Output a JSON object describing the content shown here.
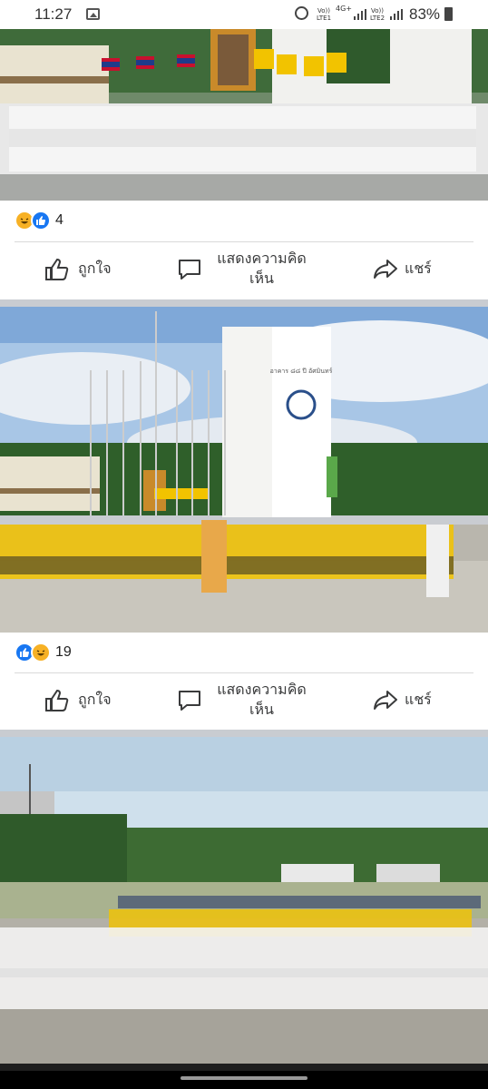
{
  "status_bar": {
    "time": "11:27",
    "sim1": "Vo)) LTE1",
    "sim1_network": "4G+",
    "sim2": "Vo)) LTE2",
    "battery": "83%"
  },
  "posts": [
    {
      "photo_icon": "image-group-officers-white-uniform",
      "reaction_icons": [
        "haha-icon",
        "like-icon"
      ],
      "reaction_count": "4",
      "like_label": "ถูกใจ",
      "comment_label": "แสดงความคิดเห็น",
      "share_label": "แชร์"
    },
    {
      "photo_icon": "image-yellow-shirts-ceremony",
      "building_sign": "อาคาร ๘๘ ปี อัศมินทร์",
      "reaction_icons": [
        "like-icon",
        "haha-icon"
      ],
      "reaction_count": "19",
      "like_label": "ถูกใจ",
      "comment_label": "แสดงความคิดเห็น",
      "share_label": "แชร์"
    },
    {
      "photo_icon": "image-field-assembly"
    }
  ],
  "colors": {
    "accent_blue": "#1877f2",
    "haha_yellow": "#f7b125",
    "divider": "#d9d9d9",
    "background": "#c9ccd1"
  }
}
